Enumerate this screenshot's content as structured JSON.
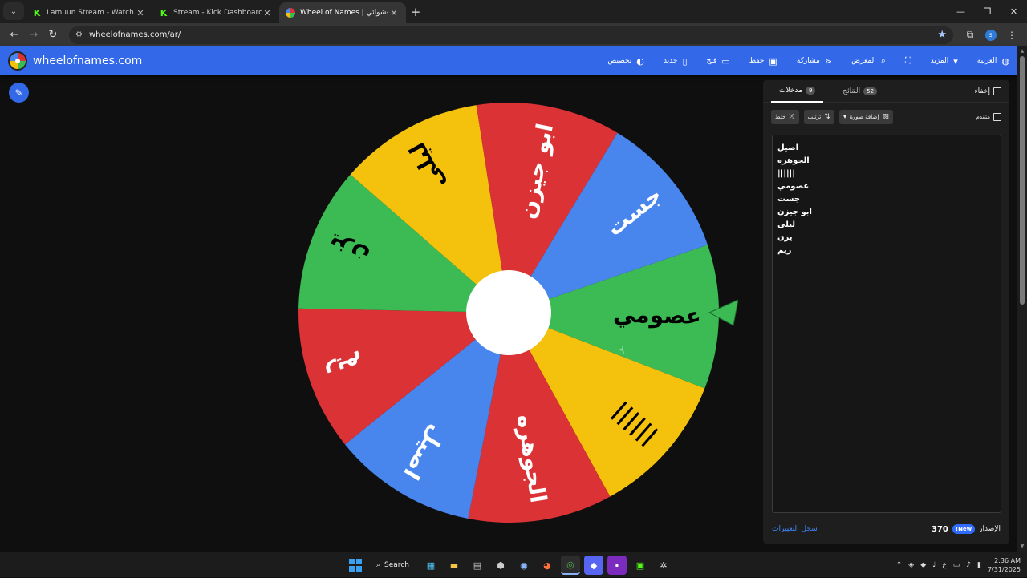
{
  "browser": {
    "tabs": [
      {
        "title": "Lamuun Stream - Watch Live o",
        "icon": "kick-icon",
        "active": false
      },
      {
        "title": "Stream - Kick Dashboard",
        "icon": "kick-icon",
        "active": false
      },
      {
        "title": "Wheel of Names | عجلة الاسم العشوائي",
        "icon": "wheel-icon",
        "active": true
      }
    ],
    "kick_glyph": "K",
    "new_tab": "+",
    "url": "wheelofnames.com/ar/",
    "profile_initial": "s"
  },
  "app": {
    "brand": "wheelofnames.com",
    "menu": [
      {
        "label": "العربية",
        "icon": "globe-icon"
      },
      {
        "label": "المزيد",
        "icon": "caret-down-icon"
      },
      {
        "label": "",
        "icon": "fullscreen-icon"
      },
      {
        "label": "المعرض",
        "icon": "search-icon"
      },
      {
        "label": "مشاركة",
        "icon": "share-icon"
      },
      {
        "label": "حفظ",
        "icon": "save-icon"
      },
      {
        "label": "فتح",
        "icon": "folder-open-icon"
      },
      {
        "label": "جديد",
        "icon": "new-file-icon"
      },
      {
        "label": "تخصيص",
        "icon": "palette-icon"
      }
    ]
  },
  "wheel": {
    "segments": [
      {
        "label": "عصومي",
        "color": "#3cba54",
        "text_color": "#000000"
      },
      {
        "label": "||||||",
        "color": "#f4c20d",
        "text_color": "#000000"
      },
      {
        "label": "الجوهره",
        "color": "#db3236",
        "text_color": "#ffffff"
      },
      {
        "label": "اصيل",
        "color": "#4885ed",
        "text_color": "#ffffff"
      },
      {
        "label": "ريم",
        "color": "#db3236",
        "text_color": "#ffffff"
      },
      {
        "label": "يزن",
        "color": "#3cba54",
        "text_color": "#000000"
      },
      {
        "label": "ليلى",
        "color": "#f4c20d",
        "text_color": "#000000"
      },
      {
        "label": "ابو جيزن",
        "color": "#db3236",
        "text_color": "#ffffff"
      },
      {
        "label": "جست",
        "color": "#4885ed",
        "text_color": "#ffffff"
      }
    ],
    "pointer_color": "#3cba54"
  },
  "panel": {
    "hide_label": "إخفاء",
    "tabs": [
      {
        "label": "مدخلات",
        "count": "9",
        "active": true
      },
      {
        "label": "النتائج",
        "count": "52",
        "active": false
      }
    ],
    "toolbar": {
      "advanced_label": "متقدم",
      "add_image_label": "إضافة صورة",
      "sort_label": "ترتيب",
      "shuffle_label": "خلط"
    },
    "entries": [
      "اصيل",
      "الجوهره",
      "||||||",
      "عصومي",
      "جست",
      "ابو جيزن",
      "ليلى",
      "يزن",
      "ريم"
    ],
    "changelog_label": "سجل التغييرات",
    "new_badge": "New!",
    "version_label": "الإصدار",
    "version_number": "370"
  },
  "taskbar": {
    "search_label": "Search",
    "time": "2:36 AM",
    "date": "7/31/2025",
    "lang": "ع"
  }
}
